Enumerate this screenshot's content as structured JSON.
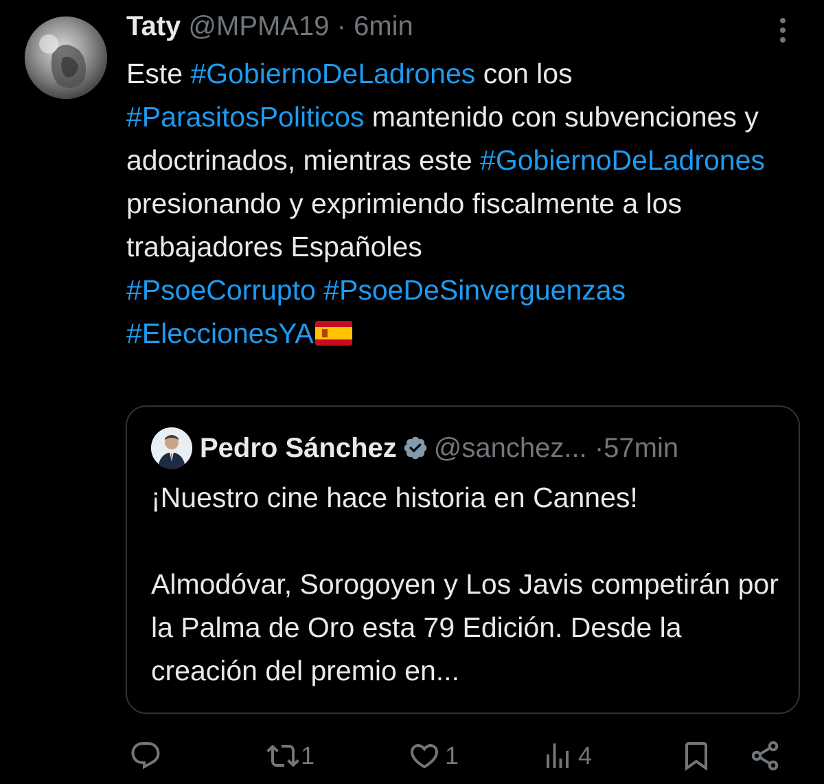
{
  "tweet": {
    "author_name": "Taty",
    "handle": "@MPMA19",
    "separator": "·",
    "time": "6min",
    "text_parts": {
      "p1": "Este ",
      "tag1": "#GobiernoDeLadrones",
      "p2": " con los",
      "tag2": "#ParasitosPoliticos",
      "p3": " mantenido con subvenciones y adoctrinados, mientras este ",
      "tag3": "#GobiernoDeLadrones",
      "p4": " presionando y exprimiendo fiscalmente a los trabajadores Españoles",
      "tag4": "#PsoeCorrupto",
      "tag5": "#PsoeDeSinverguenzas",
      "tag6": "#EleccionesYA",
      "flag": "🇪🇸"
    }
  },
  "quote": {
    "author_name": "Pedro Sánchez",
    "handle": "@sanchez...",
    "separator": "·",
    "time": "57min",
    "line1": "¡Nuestro cine hace historia en Cannes!",
    "line2": "Almodóvar, Sorogoyen y Los Javis competirán por la Palma de Oro esta 79 Edición. Desde la creación del premio en..."
  },
  "actions": {
    "reply_count": "",
    "retweet_count": "1",
    "like_count": "1",
    "views_count": "4"
  },
  "colors": {
    "background": "#000000",
    "text": "#e7e9ea",
    "muted": "#71767b",
    "link": "#1d9bf0",
    "border": "#2f3336"
  }
}
